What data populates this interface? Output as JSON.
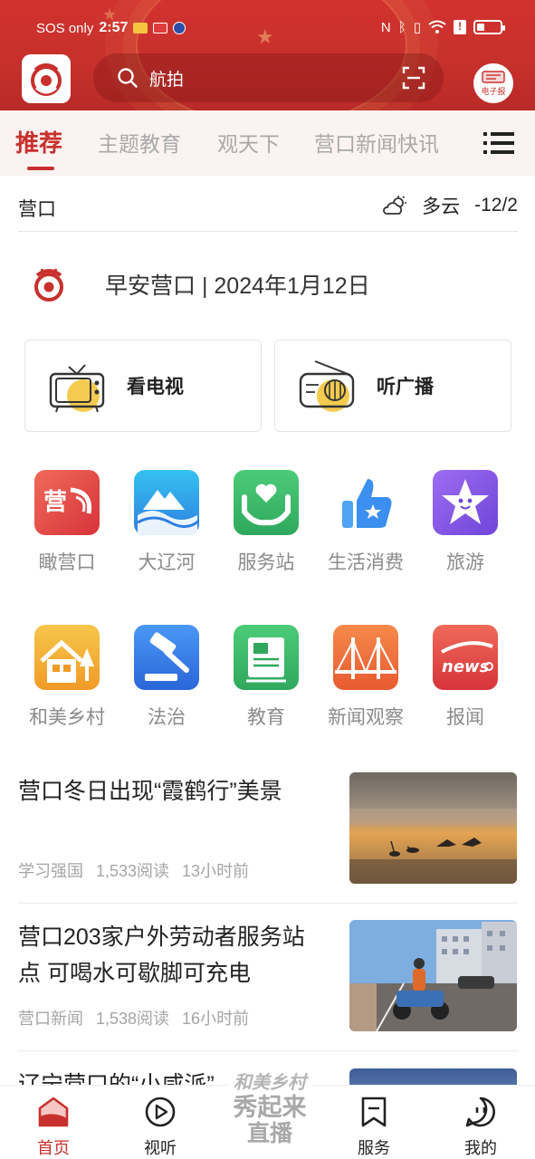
{
  "status_bar": {
    "carrier": "SOS only",
    "time": "2:57"
  },
  "header": {
    "search": {
      "placeholder": "航拍"
    },
    "epaper_label": "电子报"
  },
  "tabs": [
    {
      "label": "推荐",
      "active": true
    },
    {
      "label": "主题教育"
    },
    {
      "label": "观天下"
    },
    {
      "label": "营口新闻快讯"
    }
  ],
  "weather": {
    "city": "营口",
    "condition": "多云",
    "temperature": "-12/2"
  },
  "greeting": {
    "text": "早安营口 | 2024年1月12日"
  },
  "media_cards": [
    {
      "label": "看电视",
      "icon": "tv-icon"
    },
    {
      "label": "听广播",
      "icon": "radio-icon"
    }
  ],
  "grid": [
    {
      "label": "瞰营口",
      "icon": "yingkou-icon",
      "color": "#e8504b"
    },
    {
      "label": "大辽河",
      "icon": "river-icon",
      "color": "#2f9be0"
    },
    {
      "label": "服务站",
      "icon": "service-station-icon",
      "color": "#3cb56a"
    },
    {
      "label": "生活消费",
      "icon": "thumbs-up-icon",
      "color": "#3a8ff0"
    },
    {
      "label": "旅游",
      "icon": "star-face-icon",
      "color": "#8a5bea"
    },
    {
      "label": "和美乡村",
      "icon": "village-icon",
      "color": "#f5a623"
    },
    {
      "label": "法治",
      "icon": "gavel-icon",
      "color": "#3a7ff0"
    },
    {
      "label": "教育",
      "icon": "book-icon",
      "color": "#3cb56a"
    },
    {
      "label": "新闻观察",
      "icon": "bridge-icon",
      "color": "#ee6b3c"
    },
    {
      "label": "报闻",
      "icon": "news-icon",
      "color": "#ea4a4a"
    }
  ],
  "news": [
    {
      "title": "营口冬日出现“霞鹤行”美景",
      "source": "学习强国",
      "reads": "1,533阅读",
      "time": "13小时前"
    },
    {
      "title": "营口203家户外劳动者服务站点 可喝水可歇脚可充电",
      "source": "营口新闻",
      "reads": "1,538阅读",
      "time": "16小时前"
    },
    {
      "title": "辽宁营口的“小咸派”"
    }
  ],
  "bottom_nav": {
    "items": [
      {
        "label": "首页",
        "icon": "home-icon",
        "active": true
      },
      {
        "label": "视听",
        "icon": "play-icon"
      },
      {
        "label": "服务",
        "icon": "bookmark-icon"
      },
      {
        "label": "我的",
        "icon": "profile-icon"
      }
    ],
    "center": {
      "line1": "和美乡村",
      "line2": "秀起来",
      "line3": "直播"
    }
  },
  "colors": {
    "brand": "#c7302c",
    "accent_yellow": "#f2c230"
  }
}
